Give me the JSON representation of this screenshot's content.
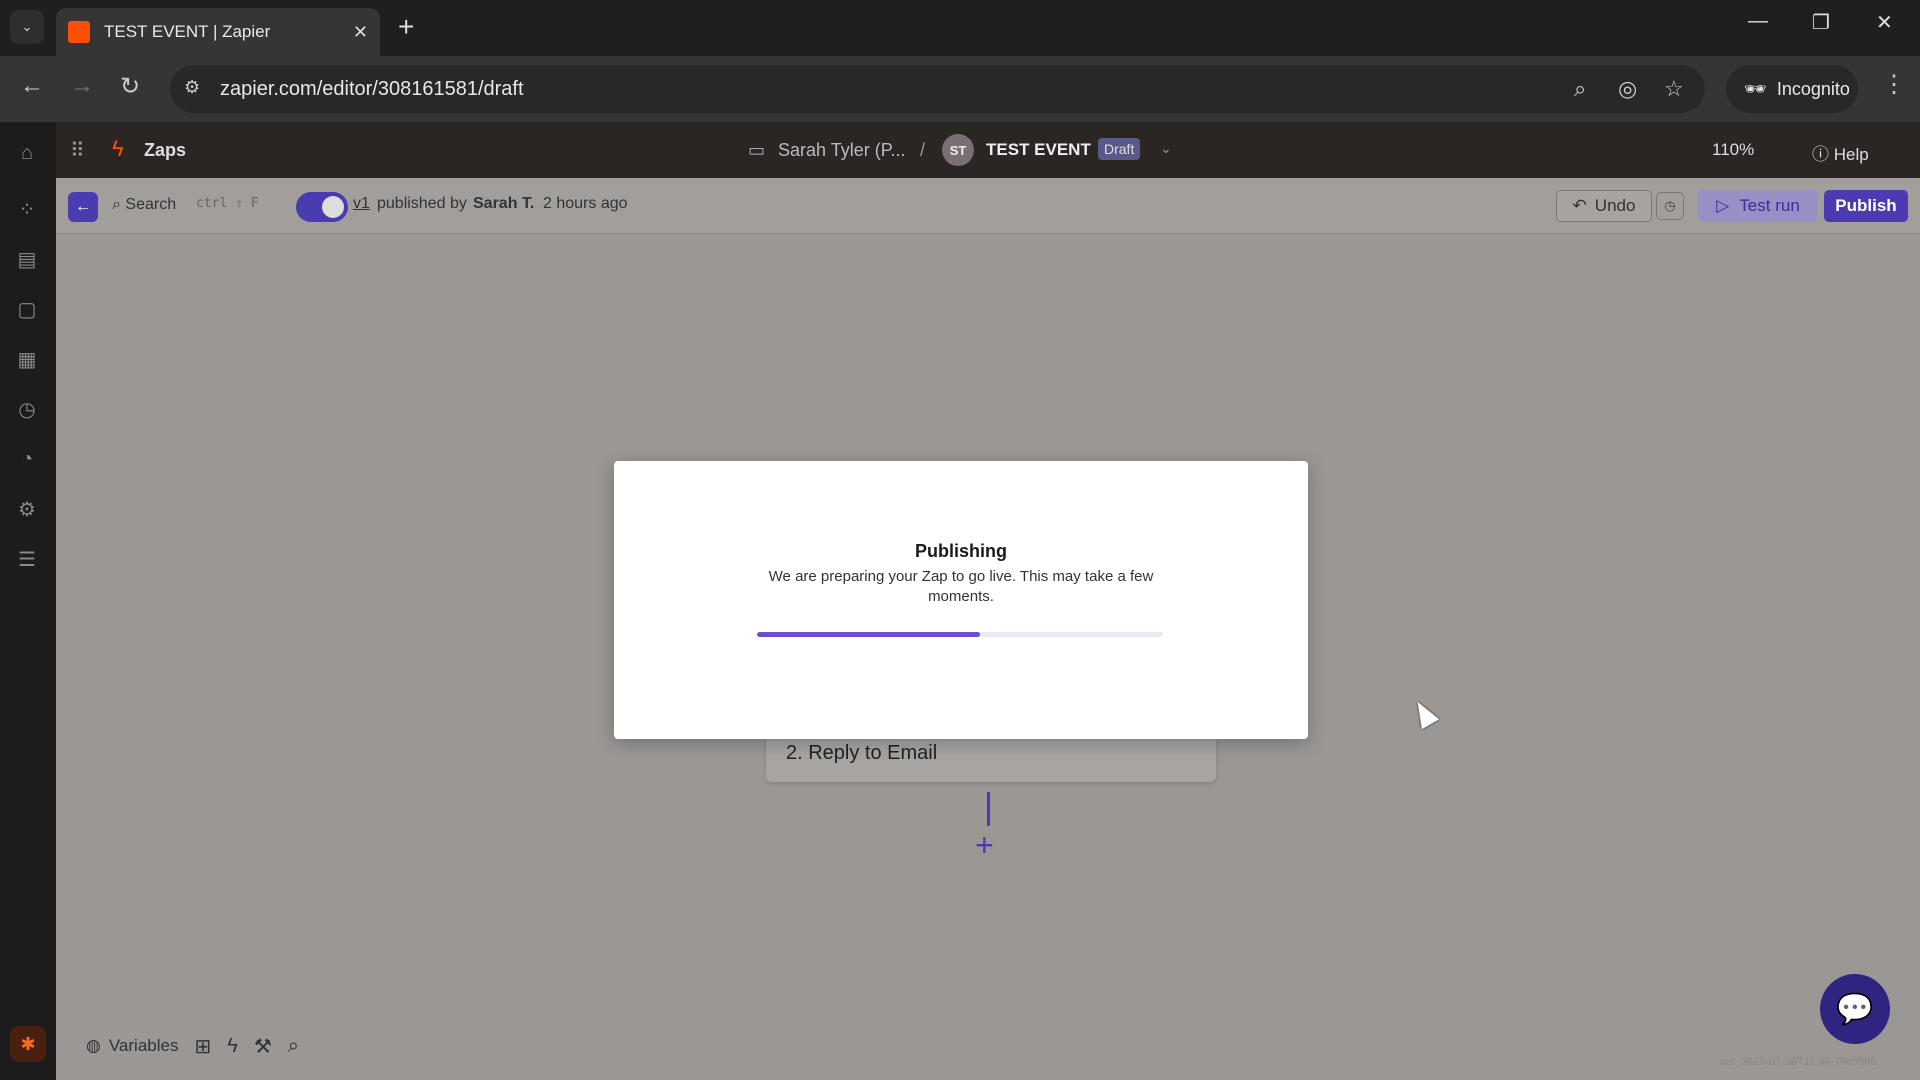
{
  "browser": {
    "tab_title": "TEST EVENT | Zapier",
    "url": "zapier.com/editor/308161581/draft",
    "incognito_label": "Incognito"
  },
  "header": {
    "app_label": "Zaps",
    "folder_owner": "Sarah Tyler (P...",
    "separator": "/",
    "avatar_initials": "ST",
    "zap_name": "TEST EVENT",
    "status_badge": "Draft",
    "zoom": "110%",
    "help_label": "Help"
  },
  "subbar": {
    "search_label": "Search",
    "shortcut": "ctrl ⇧ F",
    "version": "v1",
    "published_text": "published by",
    "published_user": "Sarah T.",
    "published_time": "2 hours ago",
    "undo_label": "Undo",
    "test_run_label": "Test run",
    "publish_label": "Publish"
  },
  "canvas": {
    "step_label": "2. Reply to Email",
    "add_symbol": "+",
    "variables_label": "Variables",
    "version_footer": "ver. 2025-07-08T11:38-79c5f9f6"
  },
  "modal": {
    "title": "Publishing",
    "message": "We are preparing your Zap to go live. This may take a few moments.",
    "progress": 0.55
  },
  "colors": {
    "accent": "#4a3bb0",
    "brand": "#ff4f00"
  }
}
